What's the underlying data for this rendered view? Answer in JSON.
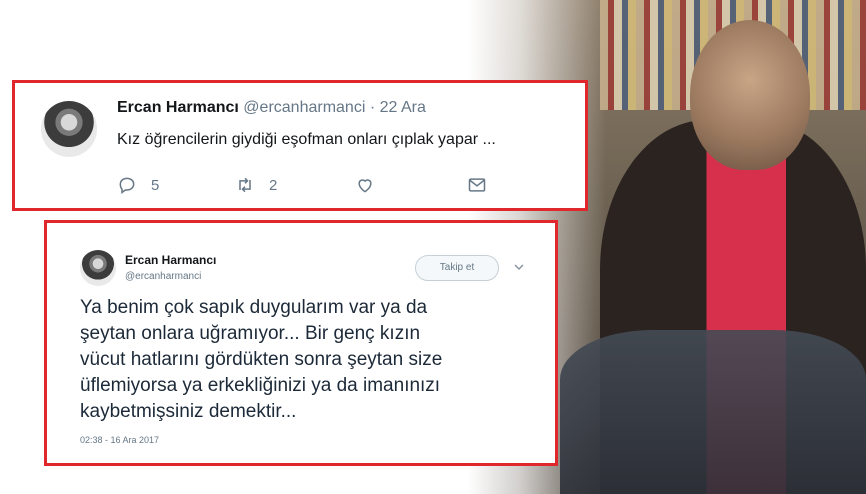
{
  "tweet1": {
    "name": "Ercan Harmancı",
    "handle": "@ercanharmanci",
    "separator": "·",
    "date": "22 Ara",
    "text": "Kız öğrencilerin giydiği eşofman onları çıplak yapar ...",
    "replies": "5",
    "retweets": "2",
    "icons": [
      "reply-icon",
      "retweet-icon",
      "like-icon",
      "message-icon"
    ]
  },
  "tweet2": {
    "name": "Ercan Harmancı",
    "handle": "@ercanharmanci",
    "follow_label": "Takip et",
    "text_lines": [
      "Ya benim çok sapık duygularım var ya da",
      "şeytan  onlara uğramıyor... Bir  genç kızın",
      "vücut hatlarını gördükten sonra şeytan size",
      "üflemiyorsa  ya erkekliğinizi ya da imanınızı",
      "kaybetmişsiniz demektir..."
    ],
    "timestamp": "02:38 - 16 Ara 2017",
    "icons": [
      "chevron-down-icon"
    ]
  },
  "colors": {
    "highlight_border": "#e0282c",
    "secondary_text": "#657786",
    "primary_text": "#14171a"
  }
}
